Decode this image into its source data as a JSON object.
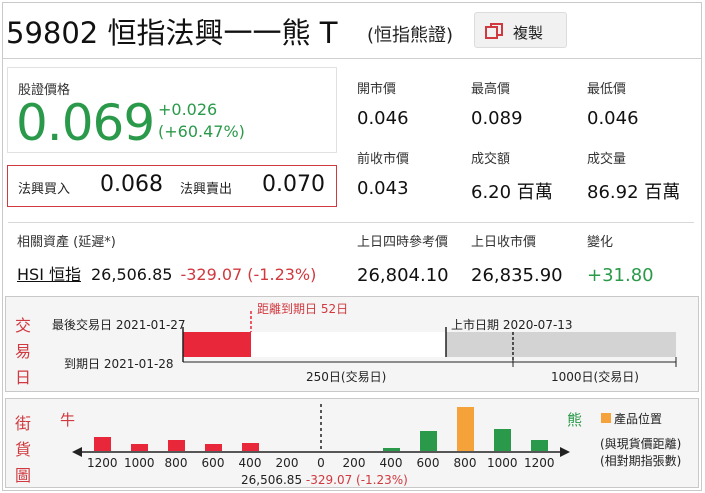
{
  "header": {
    "title": "59802 恒指法興一一熊 T",
    "subtitle": "(恒指熊證)",
    "copy_label": "複製"
  },
  "price": {
    "label": "股證價格",
    "value": "0.069",
    "change": "+0.026",
    "change_pct": "(+60.47%)"
  },
  "bidask": {
    "bid_label": "法興買入",
    "bid": "0.068",
    "ask_label": "法興賣出",
    "ask": "0.070"
  },
  "stats": {
    "open_label": "開市價",
    "open": "0.046",
    "high_label": "最高價",
    "high": "0.089",
    "low_label": "最低價",
    "low": "0.046",
    "prev_close_label": "前收市價",
    "prev_close": "0.043",
    "turnover_label": "成交額",
    "turnover": "6.20 百萬",
    "volume_label": "成交量",
    "volume": "86.92 百萬"
  },
  "underlying": {
    "label": "相關資產 (延遲*)",
    "name": "HSI 恒指",
    "value": "26,506.85",
    "change": "-329.07 (-1.23%)",
    "ref_label": "上日四時參考價",
    "ref": "26,804.10",
    "prev_close_label": "上日收市價",
    "prev_close": "26,835.90",
    "change_label": "變化",
    "change_val": "+31.80"
  },
  "trading_days": {
    "side_label": [
      "交",
      "易",
      "日"
    ],
    "last_trade": "最後交易日 2021-01-27",
    "days_to_expiry": "距離到期日 52日",
    "listing_date": "上市日期 2020-07-13",
    "expiry": "到期日 2021-01-28",
    "scale_250": "250日(交易日)",
    "scale_1000": "1000日(交易日)",
    "colors": {
      "remaining": "#e8273b",
      "elapsed": "#d3d3d3"
    }
  },
  "street": {
    "side_label": [
      "街",
      "貨",
      "圖"
    ],
    "bull_label": "牛",
    "bear_label": "熊",
    "legend_label": "產品位置",
    "note1": "(與現貨價距離)",
    "note2": "(相對期指張數)",
    "spot_line": "26,506.85",
    "spot_change": "-329.07 (-1.23%)",
    "ticks": [
      "1200",
      "1000",
      "800",
      "600",
      "400",
      "200",
      "0",
      "200",
      "400",
      "600",
      "800",
      "1000",
      "1200"
    ],
    "colors": {
      "bull": "#e8273b",
      "bear": "#2a9a4a",
      "product": "#f5a23a"
    }
  },
  "chart_data": {
    "type": "bar",
    "title": "",
    "categories": [
      "1200",
      "1000",
      "800",
      "600",
      "400",
      "400",
      "600",
      "800",
      "1000",
      "1200"
    ],
    "series": [
      {
        "name": "牛",
        "values": [
          14,
          7,
          11,
          7,
          8,
          0,
          0,
          0,
          0,
          0
        ]
      },
      {
        "name": "熊",
        "values": [
          0,
          0,
          0,
          0,
          0,
          3,
          20,
          0,
          22,
          11
        ]
      },
      {
        "name": "產品位置",
        "values": [
          0,
          0,
          0,
          0,
          0,
          0,
          0,
          44,
          0,
          0
        ]
      }
    ],
    "xlabel": "",
    "ylabel": ""
  }
}
